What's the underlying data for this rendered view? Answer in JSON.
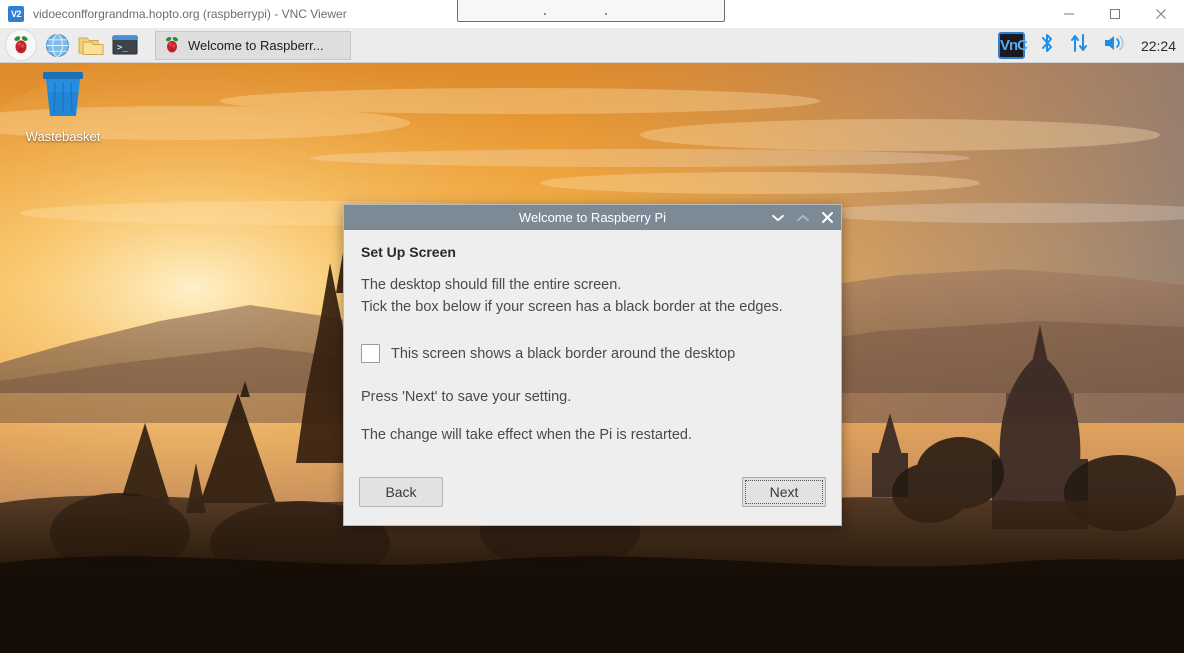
{
  "vnc_window": {
    "title": "vidoeconfforgrandma.hopto.org (raspberrypi) - VNC Viewer",
    "logo_text": "V2",
    "logo_icon": "vnc-logo-icon",
    "controls": {
      "minimize": "minimize-icon",
      "maximize": "maximize-icon",
      "close": "close-icon"
    }
  },
  "taskbar": {
    "launchers": [
      {
        "name": "raspberry-menu-icon",
        "tooltip": "Menu"
      },
      {
        "name": "web-browser-icon",
        "tooltip": "Web Browser"
      },
      {
        "name": "file-manager-icon",
        "tooltip": "File Manager"
      },
      {
        "name": "terminal-icon",
        "tooltip": "Terminal"
      }
    ],
    "window_button": {
      "label": "Welcome to Raspberr...",
      "icon": "raspberry-icon"
    },
    "tray": {
      "vnc_label": "VnC",
      "vnc_icon": "vnc-server-icon",
      "bluetooth_icon": "bluetooth-icon",
      "network_icon": "network-updown-icon",
      "volume_icon": "volume-icon",
      "clock": "22:24"
    }
  },
  "desktop": {
    "icons": [
      {
        "name": "wastebasket-icon",
        "label": "Wastebasket"
      }
    ],
    "wallpaper_colors": {
      "sky_top": "#e8952f",
      "sky_mid": "#f6c05a",
      "sun_glow": "#fde9b8",
      "sky_right": "#a78f8a",
      "haze": "#c98a56",
      "silhouette": "#3a2416",
      "foreground": "#20160e"
    }
  },
  "dialog": {
    "title": "Welcome to Raspberry Pi",
    "heading": "Set Up Screen",
    "line1": "The desktop should fill the entire screen.",
    "line2": "Tick the box below if your screen has a black border at the edges.",
    "checkbox_label": "This screen shows a black border around the desktop",
    "checkbox_checked": false,
    "para1": "Press 'Next' to save your setting.",
    "para2": "The change will take effect when the Pi is restarted.",
    "back_label": "Back",
    "next_label": "Next",
    "titlebar_color": "#7c8a96",
    "controls": {
      "minimize": "chevron-down-icon",
      "maximize": "chevron-up-icon",
      "close": "close-icon"
    }
  }
}
